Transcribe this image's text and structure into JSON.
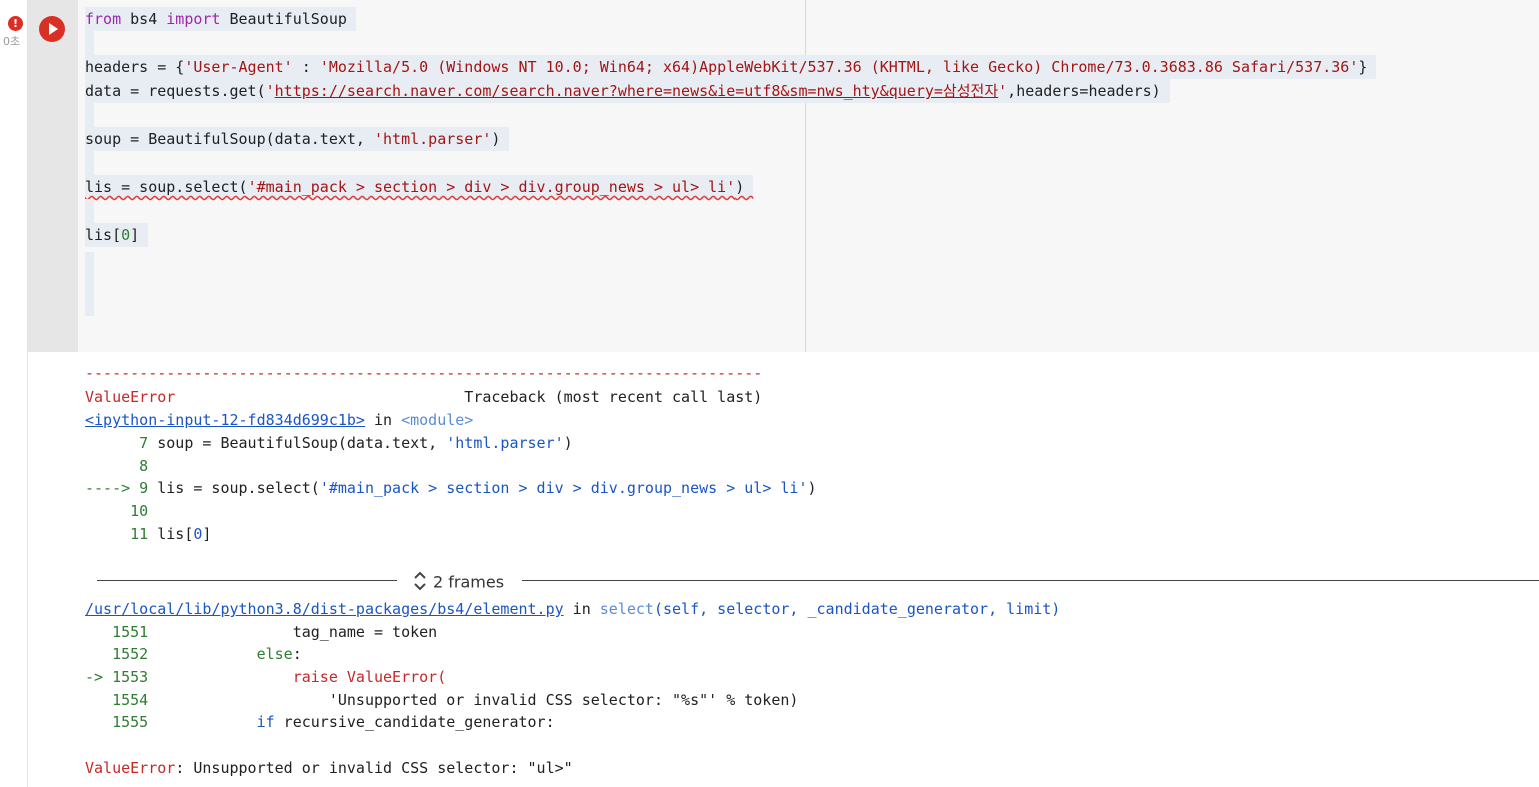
{
  "cell": {
    "exec_time": "0초",
    "error_badge": "!",
    "code_lines": {
      "l1": {
        "kw1": "from",
        "mod": " bs4 ",
        "kw2": "import",
        "rest": " BeautifulSoup "
      },
      "l3": {
        "a": "headers = {",
        "b": "'User-Agent'",
        "c": " : ",
        "d": "'Mozilla/5.0 (Windows NT 10.0; Win64; x64)AppleWebKit/537.36 (KHTML, like Gecko) Chrome/73.0.3683.86 Safari/537.36'",
        "e": "} "
      },
      "l4": {
        "a": "data = requests.get(",
        "q1": "'",
        "url": "https://search.naver.com/search.naver?where=news&ie=utf8&sm=nws_hty&query=삼성전자",
        "q2": "'",
        "b": ",headers=headers) "
      },
      "l6": {
        "a": "soup = BeautifulSoup(data.text, ",
        "b": "'html.parser'",
        "c": ") "
      },
      "l8": {
        "a": "lis = soup.select(",
        "b": "'#main_pack > section > div > div.group_news > ul> li'",
        "c": ") "
      },
      "l10": {
        "a": "lis[",
        "b": "0",
        "c": "] "
      }
    }
  },
  "output": {
    "dashes": "---------------------------------------------------------------------------",
    "error_type": "ValueError",
    "traceback_header": "                                Traceback (most recent call last)",
    "frame1": {
      "link": "<ipython-input-12-fd834d699c1b>",
      "in": " in ",
      "module": "<module>"
    },
    "tb_lines": {
      "t7": {
        "num": "      7",
        "a": " soup = BeautifulSoup(data.text, ",
        "b": "'html.parser'",
        "c": ")"
      },
      "t8": {
        "num": "      8"
      },
      "t9": {
        "arrow": "----> 9",
        "a": " lis = soup.select(",
        "b": "'#main_pack > section > div > div.group_news > ul> li'",
        "c": ")"
      },
      "t10": {
        "num": "     10"
      },
      "t11": {
        "num": "     11",
        "a": " lis[",
        "b": "0",
        "c": "]"
      }
    },
    "frames_toggle": "2 frames",
    "frame2": {
      "link": "/usr/local/lib/python3.8/dist-packages/bs4/element.py",
      "in": " in ",
      "func": "select",
      "args": "(self, selector, _candidate_generator, limit)"
    },
    "tb2_lines": {
      "t1551": {
        "num": "   1551",
        "a": "                tag_name = token"
      },
      "t1552": {
        "num": "   1552",
        "a": "            ",
        "kw": "else",
        "b": ":"
      },
      "t1553": {
        "arrow": "-> 1553",
        "a": "                ",
        "kw": "raise",
        "b": " ValueError("
      },
      "t1554": {
        "num": "   1554",
        "a": "                    'Unsupported or invalid CSS selector: \"%s\"' % token)"
      },
      "t1555": {
        "num": "   1555",
        "a": "            ",
        "kw": "if",
        "b": " recursive_candidate_generator:"
      }
    },
    "final_error": {
      "type": "ValueError",
      "msg": ": Unsupported or invalid CSS selector: \"ul>\""
    }
  },
  "colors": {
    "error_red": "#d93025",
    "link_blue": "#1a55c5",
    "keyword_purple": "#9c27b0",
    "string_red": "#a31515"
  }
}
